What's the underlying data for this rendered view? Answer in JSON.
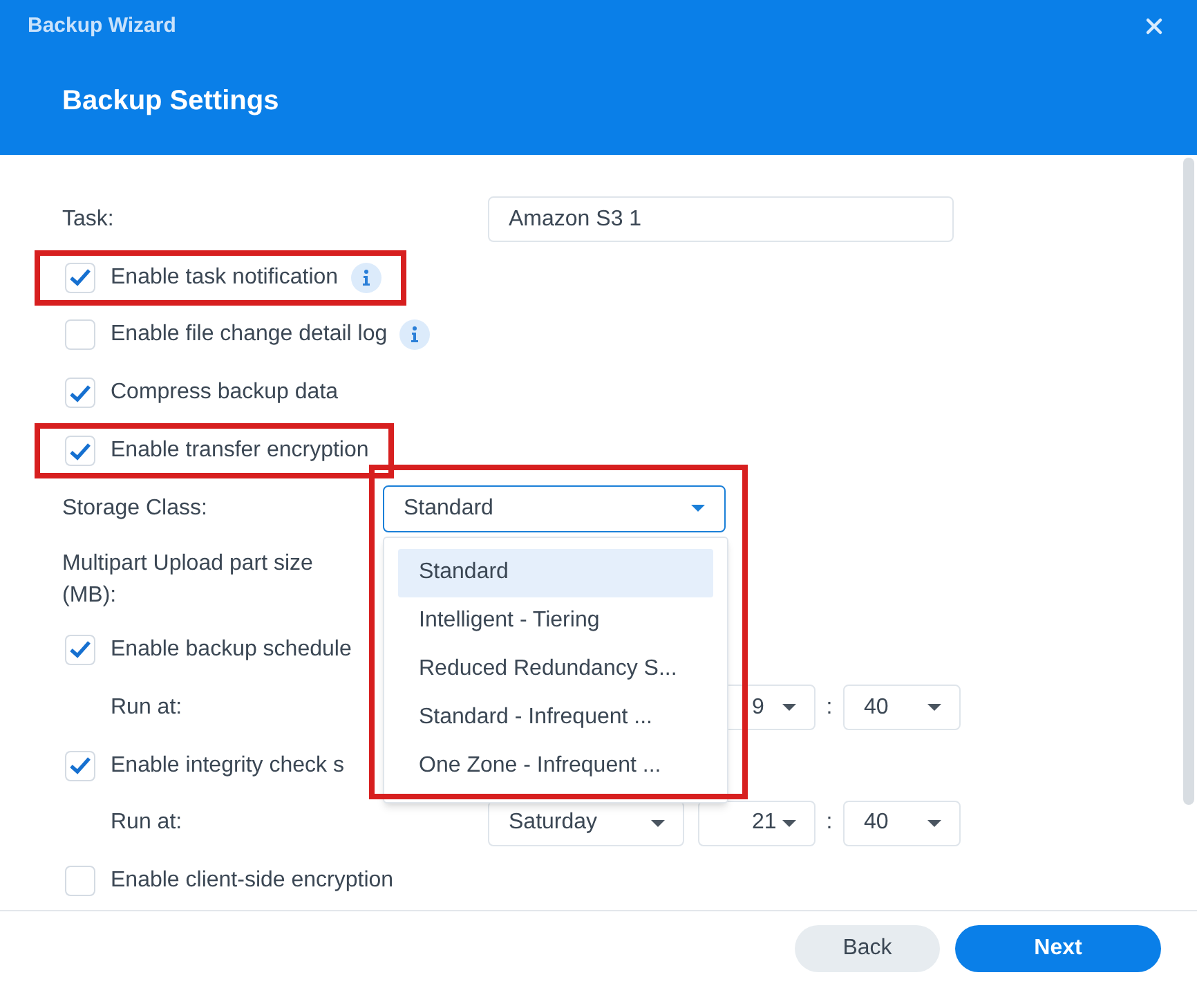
{
  "window": {
    "title": "Backup Wizard"
  },
  "header": {
    "title": "Backup Settings"
  },
  "rows": [
    {
      "kind": "text_field",
      "label": "Task:",
      "value": "Amazon S3 1"
    },
    {
      "kind": "checkbox",
      "label": "Enable task notification",
      "checked": true,
      "info": true,
      "highlighted": true
    },
    {
      "kind": "checkbox",
      "label": "Enable file change detail log",
      "checked": false,
      "info": true,
      "highlighted": false
    },
    {
      "kind": "checkbox",
      "label": "Compress backup data",
      "checked": true,
      "info": false,
      "highlighted": false
    },
    {
      "kind": "checkbox",
      "label": "Enable transfer encryption",
      "checked": true,
      "info": false,
      "highlighted": true
    },
    {
      "kind": "select",
      "label": "Storage Class:",
      "value": "Standard",
      "expanded": true,
      "highlighted": true,
      "options": [
        {
          "label": "Standard",
          "selected": true
        },
        {
          "label": "Intelligent - Tiering",
          "selected": false
        },
        {
          "label": "Reduced Redundancy S...",
          "selected": false
        },
        {
          "label": "Standard - Infrequent ...",
          "selected": false
        },
        {
          "label": "One Zone - Infrequent ...",
          "selected": false
        }
      ]
    },
    {
      "kind": "label",
      "label": "Multipart Upload part size (MB):"
    },
    {
      "kind": "checkbox",
      "label": "Enable backup schedule",
      "checked": true,
      "info": false,
      "highlighted": false
    },
    {
      "kind": "schedule",
      "label": "Run at:",
      "fields": [
        {
          "kind": "hour",
          "value": "9"
        },
        {
          "kind": "separator",
          "value": ":"
        },
        {
          "kind": "minute",
          "value": "40"
        }
      ]
    },
    {
      "kind": "checkbox",
      "label": "Enable integrity check s",
      "checked": true,
      "info": false,
      "highlighted": false
    },
    {
      "kind": "schedule",
      "label": "Run at:",
      "fields": [
        {
          "kind": "day",
          "value": "Saturday"
        },
        {
          "kind": "hour",
          "value": "21"
        },
        {
          "kind": "separator",
          "value": ":"
        },
        {
          "kind": "minute",
          "value": "40"
        }
      ]
    },
    {
      "kind": "checkbox",
      "label": "Enable client-side encryption",
      "checked": false,
      "info": false,
      "highlighted": false
    }
  ],
  "buttons": [
    {
      "label": "Back",
      "kind": "secondary"
    },
    {
      "label": "Next",
      "kind": "primary"
    }
  ]
}
